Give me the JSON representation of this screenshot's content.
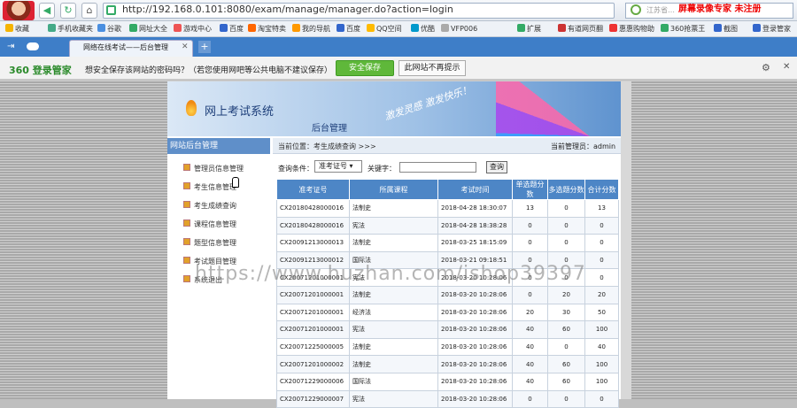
{
  "browser": {
    "url": "http://192.168.0.101:8080/exam/manage/manager.do?action=login",
    "search_placeholder": "江苏省…",
    "watermark_top": "屏幕录像专家 未注册",
    "bookmarks": [
      "收藏",
      "手机收藏夹",
      "谷歌",
      "网址大全",
      "游戏中心",
      "百度",
      "淘宝特卖",
      "我的导航",
      "百度",
      "QQ空间",
      "优酷",
      "VFP006",
      "扩展",
      "有道网页翻",
      "惠惠购物助",
      "360抢票王",
      "截图",
      "登录管家"
    ],
    "tab_title": "网络在线考试——后台管理",
    "save_prompt": "想安全保存该网站的密码吗？（若您使用网吧等公共电脑不建议保存）",
    "brand": "360 登录管家",
    "save_button": "安全保存",
    "no_prompt_button": "此网站不再提示"
  },
  "header": {
    "title": "网上考试系统",
    "subtitle": "后台管理",
    "slogan": "激发灵感 激发快乐！"
  },
  "sidebar": {
    "heading": "网站后台管理",
    "items": [
      "管理员信息管理",
      "考生信息管理",
      "考生成绩查询",
      "课程信息管理",
      "题型信息管理",
      "考试题目管理",
      "系统退出"
    ]
  },
  "crumb": {
    "text": "当前位置：考生成绩查询 >>>",
    "admin": "当前管理员：admin"
  },
  "query": {
    "label": "查询条件：",
    "select": "准考证号",
    "keyword_label": "关键字：",
    "button": "查询"
  },
  "table": {
    "headers": [
      "准考证号",
      "所属课程",
      "考试时间",
      "单选题分数",
      "多选题分数",
      "合计分数"
    ],
    "rows": [
      [
        "CX20180428000016",
        "法制史",
        "2018-04-28 18:30:07",
        "13",
        "0",
        "13"
      ],
      [
        "CX20180428000016",
        "宪法",
        "2018-04-28 18:38:28",
        "0",
        "0",
        "0"
      ],
      [
        "CX20091213000013",
        "法制史",
        "2018-03-25 18:15:09",
        "0",
        "0",
        "0"
      ],
      [
        "CX20091213000012",
        "国际法",
        "2018-03-21 09:18:51",
        "0",
        "0",
        "0"
      ],
      [
        "CX20071201000001",
        "宪法",
        "2018-03-20 10:28:06",
        "0",
        "0",
        "0"
      ],
      [
        "CX20071201000001",
        "法制史",
        "2018-03-20 10:28:06",
        "0",
        "20",
        "20"
      ],
      [
        "CX20071201000001",
        "经济法",
        "2018-03-20 10:28:06",
        "20",
        "30",
        "50"
      ],
      [
        "CX20071201000001",
        "宪法",
        "2018-03-20 10:28:06",
        "40",
        "60",
        "100"
      ],
      [
        "CX20071225000005",
        "法制史",
        "2018-03-20 10:28:06",
        "40",
        "0",
        "40"
      ],
      [
        "CX20071201000002",
        "法制史",
        "2018-03-20 10:28:06",
        "40",
        "60",
        "100"
      ],
      [
        "CX20071229000006",
        "国际法",
        "2018-03-20 10:28:06",
        "40",
        "60",
        "100"
      ],
      [
        "CX20071229000007",
        "宪法",
        "2018-03-20 10:28:06",
        "0",
        "0",
        "0"
      ]
    ]
  },
  "watermark": "https://www.huzhan.com/ishop39397"
}
